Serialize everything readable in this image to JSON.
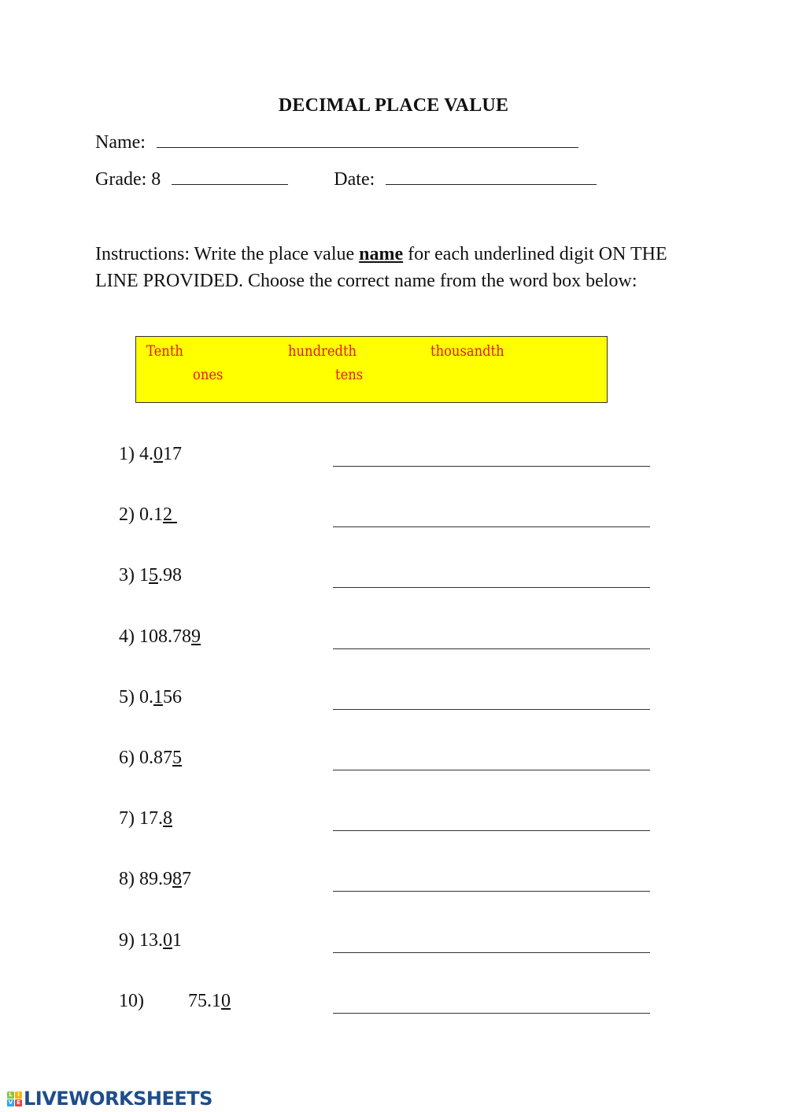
{
  "worksheet": {
    "title": "DECIMAL PLACE VALUE",
    "name_label": "Name:",
    "grade_label": "Grade: 8",
    "date_label": "Date:",
    "instructions": {
      "before": "Instructions: Write the place value ",
      "emphasis": "name",
      "after": " for each underlined digit ON THE LINE PROVIDED. Choose the correct name from the word box below:"
    },
    "word_box": {
      "background": "#ffff00",
      "text_color": "#e31b1b",
      "words": [
        "Tenth",
        "hundredth",
        "thousandth",
        "ones",
        "tens"
      ]
    },
    "items": [
      {
        "label": "1) ",
        "pre": "4.",
        "underlined": "0",
        "post": "17"
      },
      {
        "label": "2) ",
        "pre": "0.1",
        "underlined": "2 ",
        "post": ""
      },
      {
        "label": "3) ",
        "pre": "1",
        "underlined": "5",
        "post": ".98"
      },
      {
        "label": "4) ",
        "pre": "108.78",
        "underlined": "9",
        "post": ""
      },
      {
        "label": "5) ",
        "pre": "0.",
        "underlined": "1",
        "post": "56"
      },
      {
        "label": "6) ",
        "pre": "0.87",
        "underlined": "5",
        "post": ""
      },
      {
        "label": "7) ",
        "pre": "17.",
        "underlined": "8",
        "post": ""
      },
      {
        "label": "8) ",
        "pre": "89.9",
        "underlined": "8",
        "post": "7"
      },
      {
        "label": "9) ",
        "pre": "13.",
        "underlined": "0",
        "post": "1"
      },
      {
        "label": "10)",
        "pre": "75.1",
        "underlined": "0",
        "post": ""
      }
    ]
  },
  "footer": {
    "logo_letters": [
      "L",
      "I",
      "V",
      "E"
    ],
    "logo_colors": [
      "#8cc63f",
      "#f7b500",
      "#29abe2",
      "#e8453c"
    ],
    "logo_text": "LIVEWORKSHEETS"
  }
}
